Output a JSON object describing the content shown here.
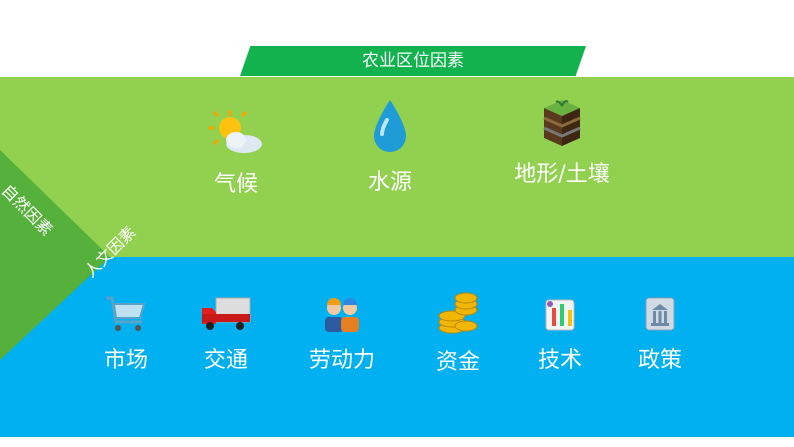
{
  "title": "农业区位因素",
  "natural": {
    "label": "自然因素",
    "items": [
      {
        "label": "气候",
        "icon": "sun-cloud-icon"
      },
      {
        "label": "水源",
        "icon": "water-drop-icon"
      },
      {
        "label": "地形/土壤",
        "icon": "soil-layers-icon"
      }
    ]
  },
  "human": {
    "label": "人文因素",
    "items": [
      {
        "label": "市场",
        "icon": "shopping-cart-icon"
      },
      {
        "label": "交通",
        "icon": "truck-icon"
      },
      {
        "label": "劳动力",
        "icon": "workers-icon"
      },
      {
        "label": "资金",
        "icon": "coins-icon"
      },
      {
        "label": "技术",
        "icon": "lab-icon"
      },
      {
        "label": "政策",
        "icon": "government-icon"
      }
    ]
  },
  "colors": {
    "banner": "#12b24e",
    "natural_band": "#92d050",
    "human_band": "#00b0f0",
    "corner_tab": "#55b13b"
  }
}
